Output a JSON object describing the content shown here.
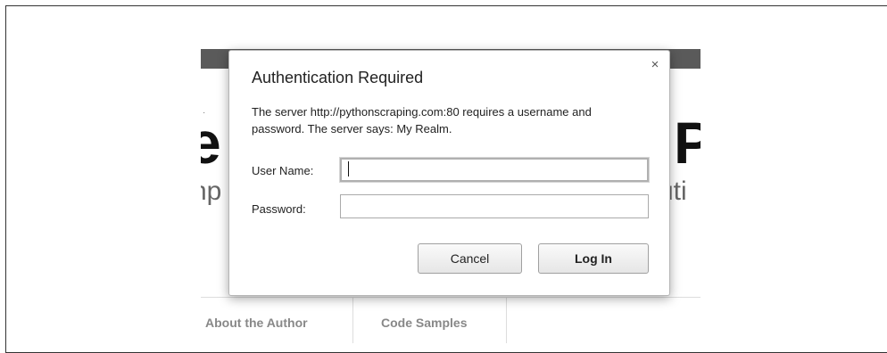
{
  "background_page": {
    "big_left": "e",
    "big_right": "P",
    "sub_left": "np",
    "sub_right": "uti",
    "dot": "·",
    "nav": [
      "About the Author",
      "Code Samples"
    ]
  },
  "dialog": {
    "title": "Authentication Required",
    "close_icon": "×",
    "message": "The server http://pythonscraping.com:80 requires a username and password. The server says: My Realm.",
    "username_label": "User Name:",
    "username_value": "",
    "password_label": "Password:",
    "password_value": "",
    "cancel_label": "Cancel",
    "login_label": "Log In"
  }
}
